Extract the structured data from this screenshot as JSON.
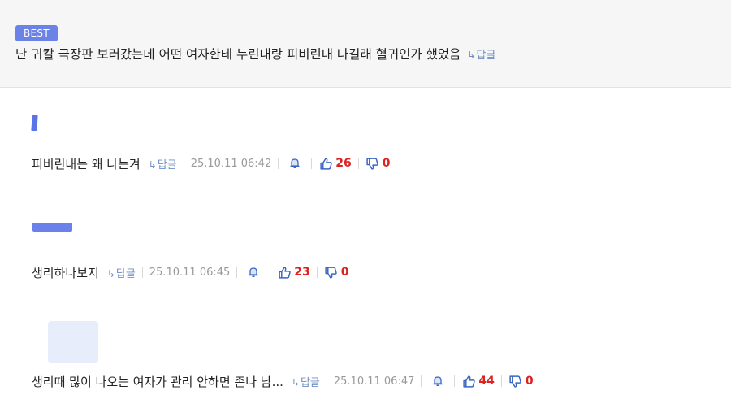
{
  "best_post": {
    "badge": "BEST",
    "text": "난 귀칼 극장판 보러갔는데 어떤 여자한테 누린내랑 피비린내 나길래 혈귀인가 했었음",
    "reply_label": "답글"
  },
  "comments": [
    {
      "text": "피비린내는 왜 나는겨",
      "reply_label": "답글",
      "date": "25.10.11 06:42",
      "likes": "26",
      "dislikes": "0"
    },
    {
      "text": "생리하나보지",
      "reply_label": "답글",
      "date": "25.10.11 06:45",
      "likes": "23",
      "dislikes": "0"
    },
    {
      "text": "생리때 많이 나오는 여자가 관리 안하면 존나 남...",
      "reply_label": "답글",
      "date": "25.10.11 06:47",
      "likes": "44",
      "dislikes": "0"
    }
  ],
  "icons": {
    "reply": "reply-arrow-icon",
    "report": "bell-icon",
    "like": "thumbs-up-icon",
    "dislike": "thumbs-down-icon"
  },
  "colors": {
    "badge": "#6b82e6",
    "reply": "#6f8fc4",
    "count": "#dd2222",
    "icon": "#3a66c4"
  }
}
